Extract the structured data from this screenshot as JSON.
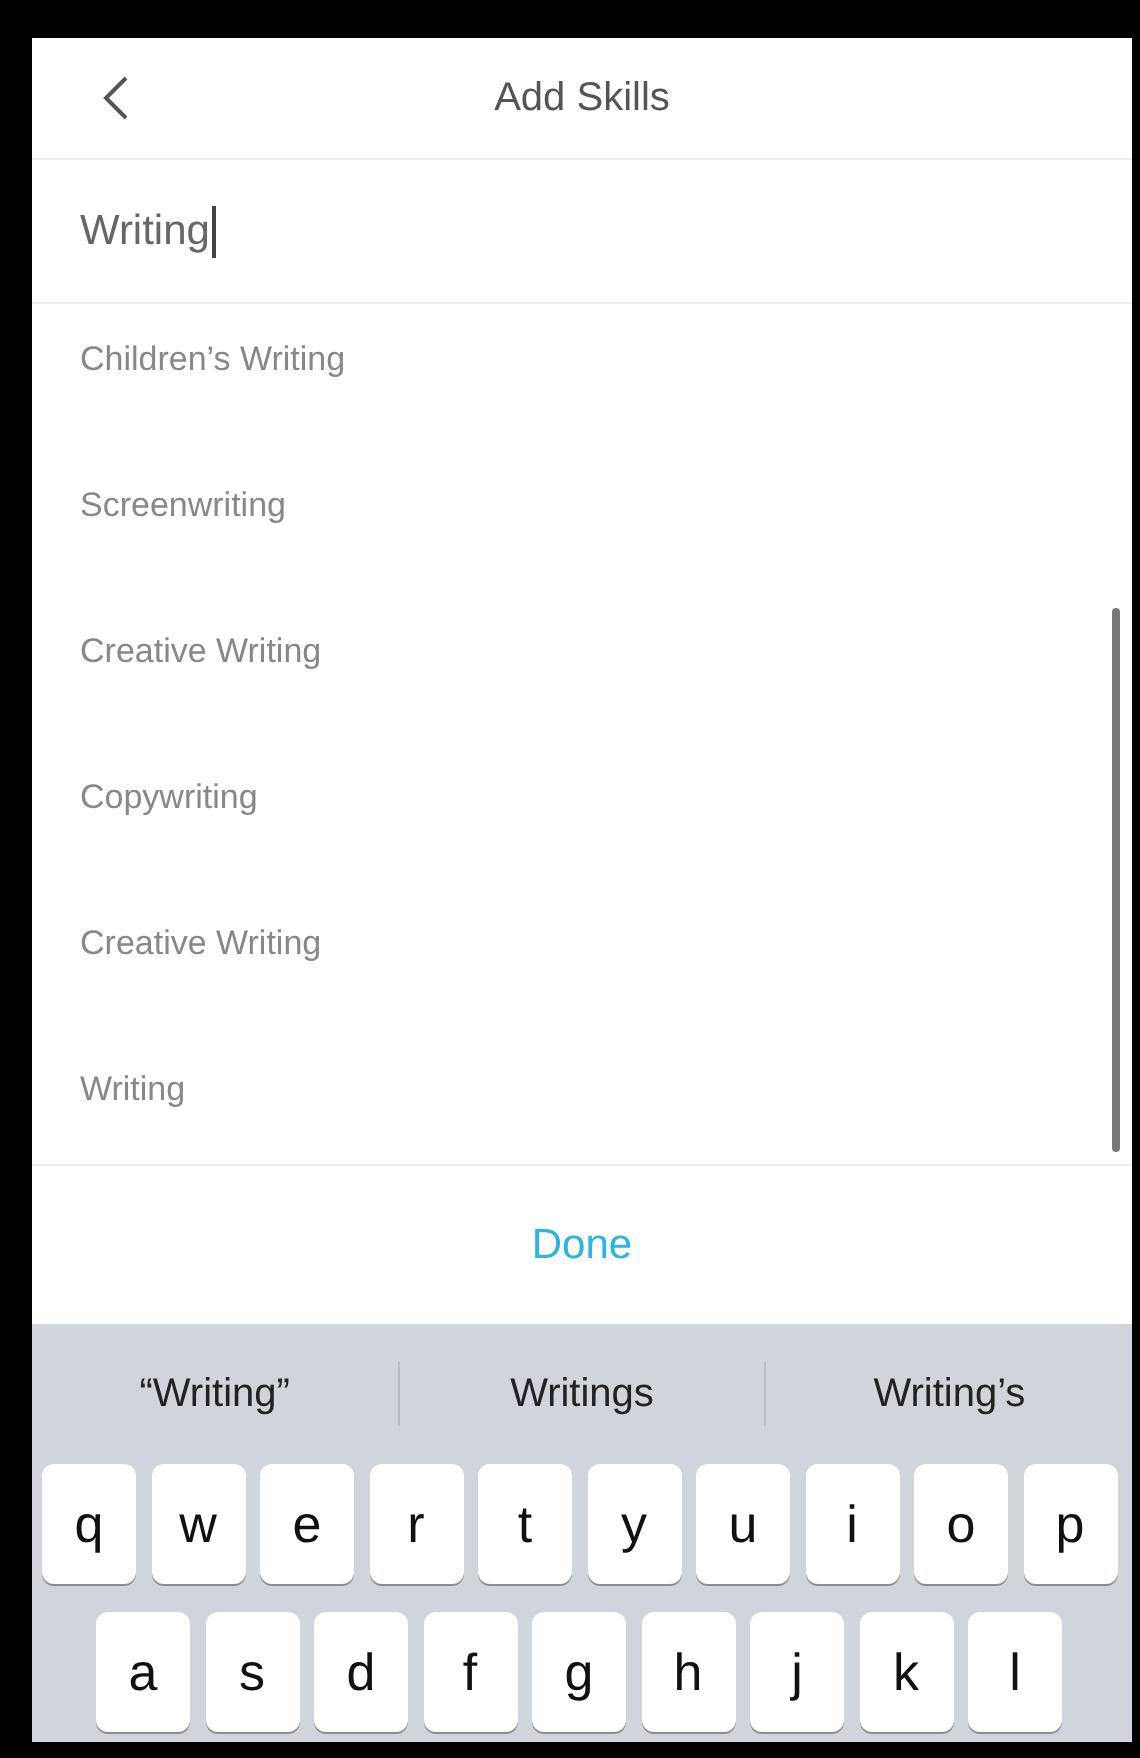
{
  "header": {
    "title": "Add Skills"
  },
  "search": {
    "value": "Writing"
  },
  "suggestions": [
    "Children’s Writing",
    "Screenwriting",
    "Creative Writing",
    "Copywriting",
    "Creative Writing",
    "Writing"
  ],
  "done_button": "Done",
  "keyboard": {
    "predictions": [
      "“Writing”",
      "Writings",
      "Writing’s"
    ],
    "rows": [
      [
        "q",
        "w",
        "e",
        "r",
        "t",
        "y",
        "u",
        "i",
        "o",
        "p"
      ],
      [
        "a",
        "s",
        "d",
        "f",
        "g",
        "h",
        "j",
        "k",
        "l"
      ]
    ]
  }
}
